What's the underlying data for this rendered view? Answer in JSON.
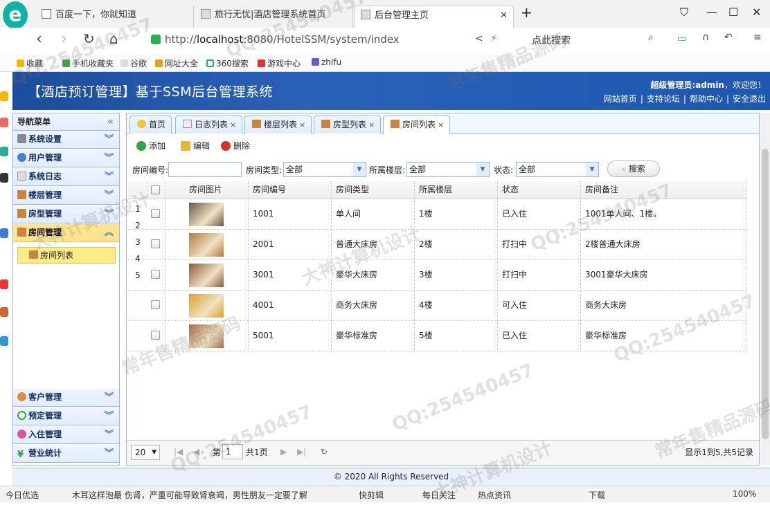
{
  "browser": {
    "tabs": [
      {
        "label": "百度一下，你就知道"
      },
      {
        "label": "旅行无忧|酒店管理系统首页"
      },
      {
        "label": "后台管理主页"
      }
    ],
    "new_tab": "+",
    "url_prefix": "http://",
    "url_host": "localhost",
    "url_rest": ":8080/HotelSSM/system/index",
    "search_placeholder": "点此搜索",
    "bookmarks": [
      "收藏",
      "手机收藏夹",
      "谷歌",
      "网址大全",
      "360搜索",
      "游戏中心",
      "zhifu"
    ]
  },
  "header": {
    "title": "【酒店预订管理】基于SSM后台管理系统",
    "welcome_prefix": "超级管理员:admin",
    "welcome_suffix": "，欢迎您！",
    "links": [
      "网站首页",
      "支持论坛",
      "帮助中心",
      "安全退出"
    ]
  },
  "sidebar": {
    "title": "导航菜单",
    "groups": [
      {
        "label": "系统设置"
      },
      {
        "label": "用户管理"
      },
      {
        "label": "系统日志"
      },
      {
        "label": "楼层管理"
      },
      {
        "label": "房型管理"
      },
      {
        "label": "房间管理"
      },
      {
        "label": "客户管理"
      },
      {
        "label": "预定管理"
      },
      {
        "label": "入住管理"
      },
      {
        "label": "营业统计"
      }
    ],
    "sub_item": "房间列表"
  },
  "tabs": [
    {
      "label": "首页"
    },
    {
      "label": "日志列表"
    },
    {
      "label": "楼层列表"
    },
    {
      "label": "房型列表"
    },
    {
      "label": "房间列表"
    }
  ],
  "toolbar": {
    "add": "添加",
    "edit": "编辑",
    "delete": "删除"
  },
  "filters": {
    "room_no_label": "房间编号:",
    "room_type_label": "房间类型:",
    "room_type_value": "全部",
    "floor_label": "所属楼层:",
    "floor_value": "全部",
    "status_label": "状态:",
    "status_value": "全部",
    "search": "搜索"
  },
  "grid": {
    "columns": [
      "房间图片",
      "房间编号",
      "房间类型",
      "所属楼层",
      "状态",
      "房间备注"
    ],
    "rows": [
      {
        "no": "1001",
        "type": "单人间",
        "floor": "1楼",
        "status": "已入住",
        "remark": "1001单人间、1楼。",
        "img": "#6b5648"
      },
      {
        "no": "2001",
        "type": "普通大床房",
        "floor": "2楼",
        "status": "打扫中",
        "remark": "2楼普通大床房",
        "img": "#b27a3c"
      },
      {
        "no": "3001",
        "type": "豪华大床房",
        "floor": "3楼",
        "status": "打扫中",
        "remark": "3001豪华大床房",
        "img": "#8a5a3a"
      },
      {
        "no": "4001",
        "type": "商务大床房",
        "floor": "4楼",
        "status": "可入住",
        "remark": "商务大床房",
        "img": "#d9a02b"
      },
      {
        "no": "5001",
        "type": "豪华标准房",
        "floor": "5楼",
        "status": "已入住",
        "remark": "豪华标准房",
        "img": "#a06a3e"
      }
    ],
    "row_numbers": [
      "1",
      "2",
      "3",
      "4",
      "5"
    ]
  },
  "pager": {
    "page_size": "20",
    "page_prefix": "第",
    "page_value": "1",
    "page_total": "共1页",
    "summary": "显示1到5,共5记录"
  },
  "footer": "© 2020 All Rights Reserved",
  "statusbar": [
    "今日优选",
    "木耳这样泡最 伤肾，严重可能导致肾衰竭，男性朋友一定要了解",
    "快剪辑",
    "每日关注",
    "热点资讯",
    "下载",
    "100%"
  ],
  "watermarks": [
    "QQ:254540457",
    "常年售精品源码",
    "大神计算机设计"
  ]
}
